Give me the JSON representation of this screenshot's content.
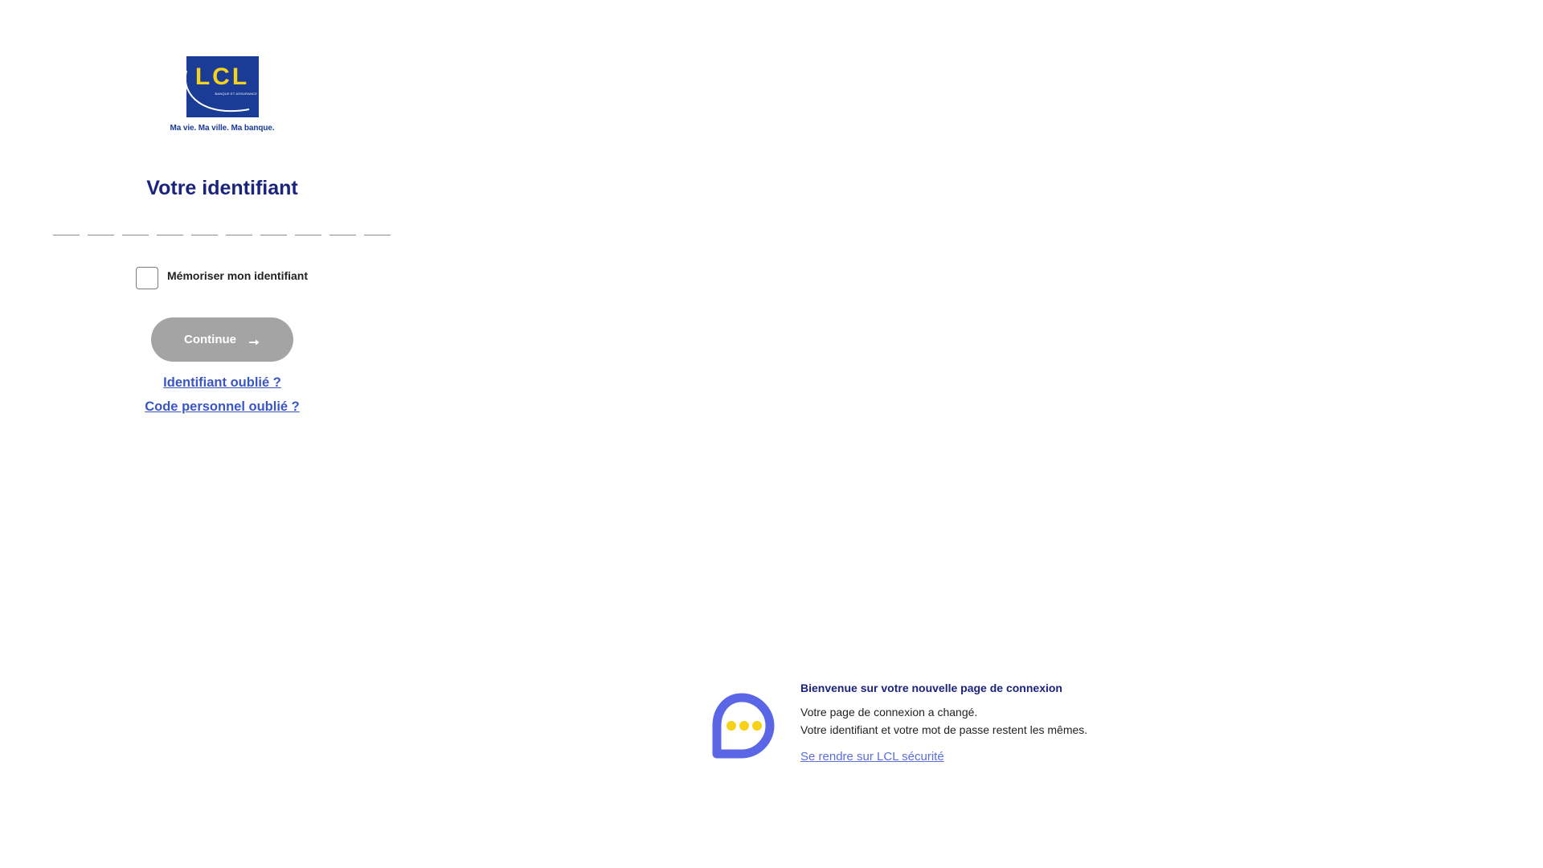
{
  "brand": {
    "logo_text": "LCL",
    "logo_subtext": "BANQUE ET ASSURANCE",
    "tagline": "Ma vie. Ma ville. Ma banque.",
    "colors": {
      "logo_background": "#1b3c96",
      "logo_letters": "#f6d21a",
      "title": "#1a237e",
      "link": "#3a56c4",
      "button_disabled": "#a4a4a4",
      "chat_icon": "#5b66e6",
      "chat_dots": "#f6d21a"
    }
  },
  "login": {
    "title": "Votre identifiant",
    "digit_fields_count": 10,
    "digits": [
      "",
      "",
      "",
      "",
      "",
      "",
      "",
      "",
      "",
      ""
    ],
    "remember_label": "Mémoriser mon identifiant",
    "remember_checked": false,
    "continue_label": "Continue",
    "continue_icon": "arrow-right-icon",
    "continue_enabled": false,
    "forgot_id_link": "Identifiant oublié ?",
    "forgot_code_link": "Code personnel oublié ?"
  },
  "info": {
    "icon": "chat-bubble-icon",
    "title": "Bienvenue sur votre nouvelle page de connexion",
    "line1": "Votre page de connexion a changé.",
    "line2": "Votre identifiant et votre mot de passe restent les mêmes.",
    "link": "Se rendre sur LCL sécurité"
  }
}
